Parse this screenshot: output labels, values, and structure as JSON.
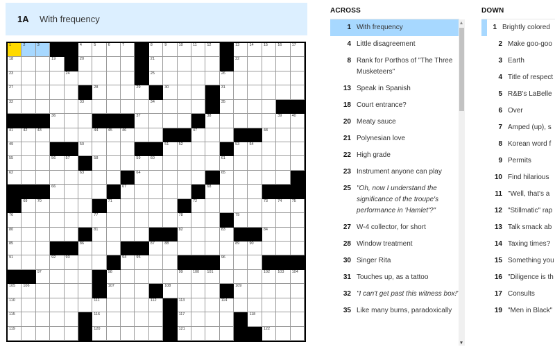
{
  "current_clue": {
    "label": "1A",
    "text": "With frequency"
  },
  "grid": {
    "rows": 21,
    "cols": 21,
    "black_cells": {
      "0": [
        3,
        4,
        9,
        15
      ],
      "1": [
        4,
        9,
        15
      ],
      "2": [
        9
      ],
      "3": [
        5,
        10,
        14
      ],
      "4": [
        14,
        19,
        20
      ],
      "5": [
        0,
        1,
        2,
        6,
        7,
        8,
        13
      ],
      "6": [
        11,
        12,
        16,
        17
      ],
      "7": [
        3,
        4,
        9,
        10,
        15
      ],
      "8": [
        5
      ],
      "9": [
        8,
        14,
        20
      ],
      "10": [
        0,
        1,
        2,
        7,
        13,
        18,
        19,
        20
      ],
      "11": [
        0,
        6,
        12
      ],
      "12": [
        15
      ],
      "13": [
        5,
        10,
        11,
        16,
        17
      ],
      "14": [
        3,
        4,
        8,
        9
      ],
      "15": [
        7,
        12,
        13,
        14,
        18,
        19,
        20
      ],
      "16": [
        0,
        1,
        6
      ],
      "17": [
        6,
        10,
        15
      ],
      "18": [
        11
      ],
      "19": [
        5,
        11,
        16
      ],
      "20": [
        5,
        11,
        16,
        17
      ]
    },
    "selected_cell": [
      0,
      0
    ],
    "highlighted_word": [
      [
        0,
        1
      ],
      [
        0,
        2
      ]
    ]
  },
  "across": {
    "heading": "ACROSS",
    "clues": [
      {
        "num": "1",
        "text": "With frequency",
        "active": true
      },
      {
        "num": "4",
        "text": "Little disagreement"
      },
      {
        "num": "8",
        "text": "Rank for Porthos of \"The Three Musketeers\""
      },
      {
        "num": "13",
        "text": "Speak in Spanish"
      },
      {
        "num": "18",
        "text": "Court entrance?"
      },
      {
        "num": "20",
        "text": "Meaty sauce"
      },
      {
        "num": "21",
        "text": "Polynesian love"
      },
      {
        "num": "22",
        "text": "High grade"
      },
      {
        "num": "23",
        "text": "Instrument anyone can play"
      },
      {
        "num": "25",
        "text": "\"Oh, now I understand the significance of the troupe's performance in 'Hamlet'?\"",
        "italic": true
      },
      {
        "num": "27",
        "text": "W-4 collector, for short"
      },
      {
        "num": "28",
        "text": "Window treatment"
      },
      {
        "num": "30",
        "text": "Singer Rita"
      },
      {
        "num": "31",
        "text": "Touches up, as a tattoo"
      },
      {
        "num": "32",
        "text": "\"I can't get past this witness box!\"",
        "italic": true
      },
      {
        "num": "35",
        "text": "Like many burns, paradoxically"
      }
    ]
  },
  "down": {
    "heading": "DOWN",
    "clues": [
      {
        "num": "1",
        "text": "Brightly colored",
        "crossing": true
      },
      {
        "num": "2",
        "text": "Make goo-goo"
      },
      {
        "num": "3",
        "text": "Earth"
      },
      {
        "num": "4",
        "text": "Title of respect"
      },
      {
        "num": "5",
        "text": "R&B's LaBelle"
      },
      {
        "num": "6",
        "text": "Over"
      },
      {
        "num": "7",
        "text": "Amped (up), s"
      },
      {
        "num": "8",
        "text": "Korean word f"
      },
      {
        "num": "9",
        "text": "Permits"
      },
      {
        "num": "10",
        "text": "Find hilarious"
      },
      {
        "num": "11",
        "text": "\"Well, that's a"
      },
      {
        "num": "12",
        "text": "\"Stillmatic\" rap"
      },
      {
        "num": "13",
        "text": "Talk smack ab"
      },
      {
        "num": "14",
        "text": "Taxing times?"
      },
      {
        "num": "15",
        "text": "Something you pass on"
      },
      {
        "num": "16",
        "text": "\"Diligence is th good ___\": Be"
      },
      {
        "num": "17",
        "text": "Consults"
      },
      {
        "num": "19",
        "text": "\"Men in Black\""
      }
    ]
  },
  "colors": {
    "selected_cell": "#ffda00",
    "highlighted_word": "#a7d8ff",
    "clue_bar": "#dcefff"
  }
}
